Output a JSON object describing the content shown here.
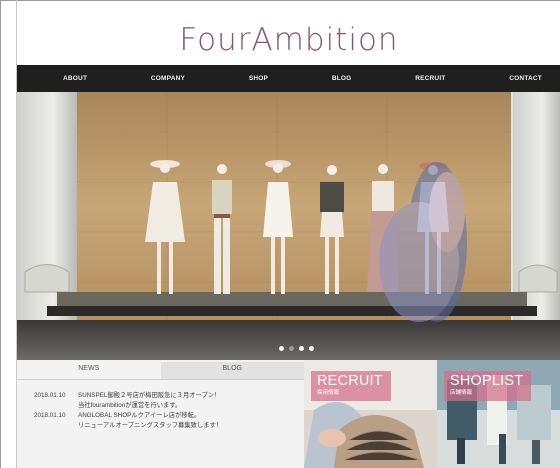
{
  "logo": "FourAmbition",
  "nav": [
    "ABOUT",
    "COMPANY",
    "SHOP",
    "BLOG",
    "RECRUIT",
    "CONTACT"
  ],
  "tabs": [
    "NEWS",
    "BLOG"
  ],
  "news": [
    {
      "date": "2018.01.10",
      "text": "SUNSPEL御殿２号店が梅田阪急に３月オープン！"
    },
    {
      "date": "",
      "text": "当社fourambitionが運営を行います。"
    },
    {
      "date": "2018.01.10",
      "text": "ANGLOBAL SHOPルクアイーレ店が移転。"
    },
    {
      "date": "",
      "text": "リニューアルオープニングスタッフ募集致します！"
    }
  ],
  "recruit": {
    "title": "RECRUIT",
    "sub": "採用情報"
  },
  "shoplist": {
    "title": "SHOPLIST",
    "sub": "店舗情報"
  },
  "colors": {
    "brand": "#8d5464",
    "nav_bg": "#1f1f1f",
    "badge": "#d66e8b"
  }
}
